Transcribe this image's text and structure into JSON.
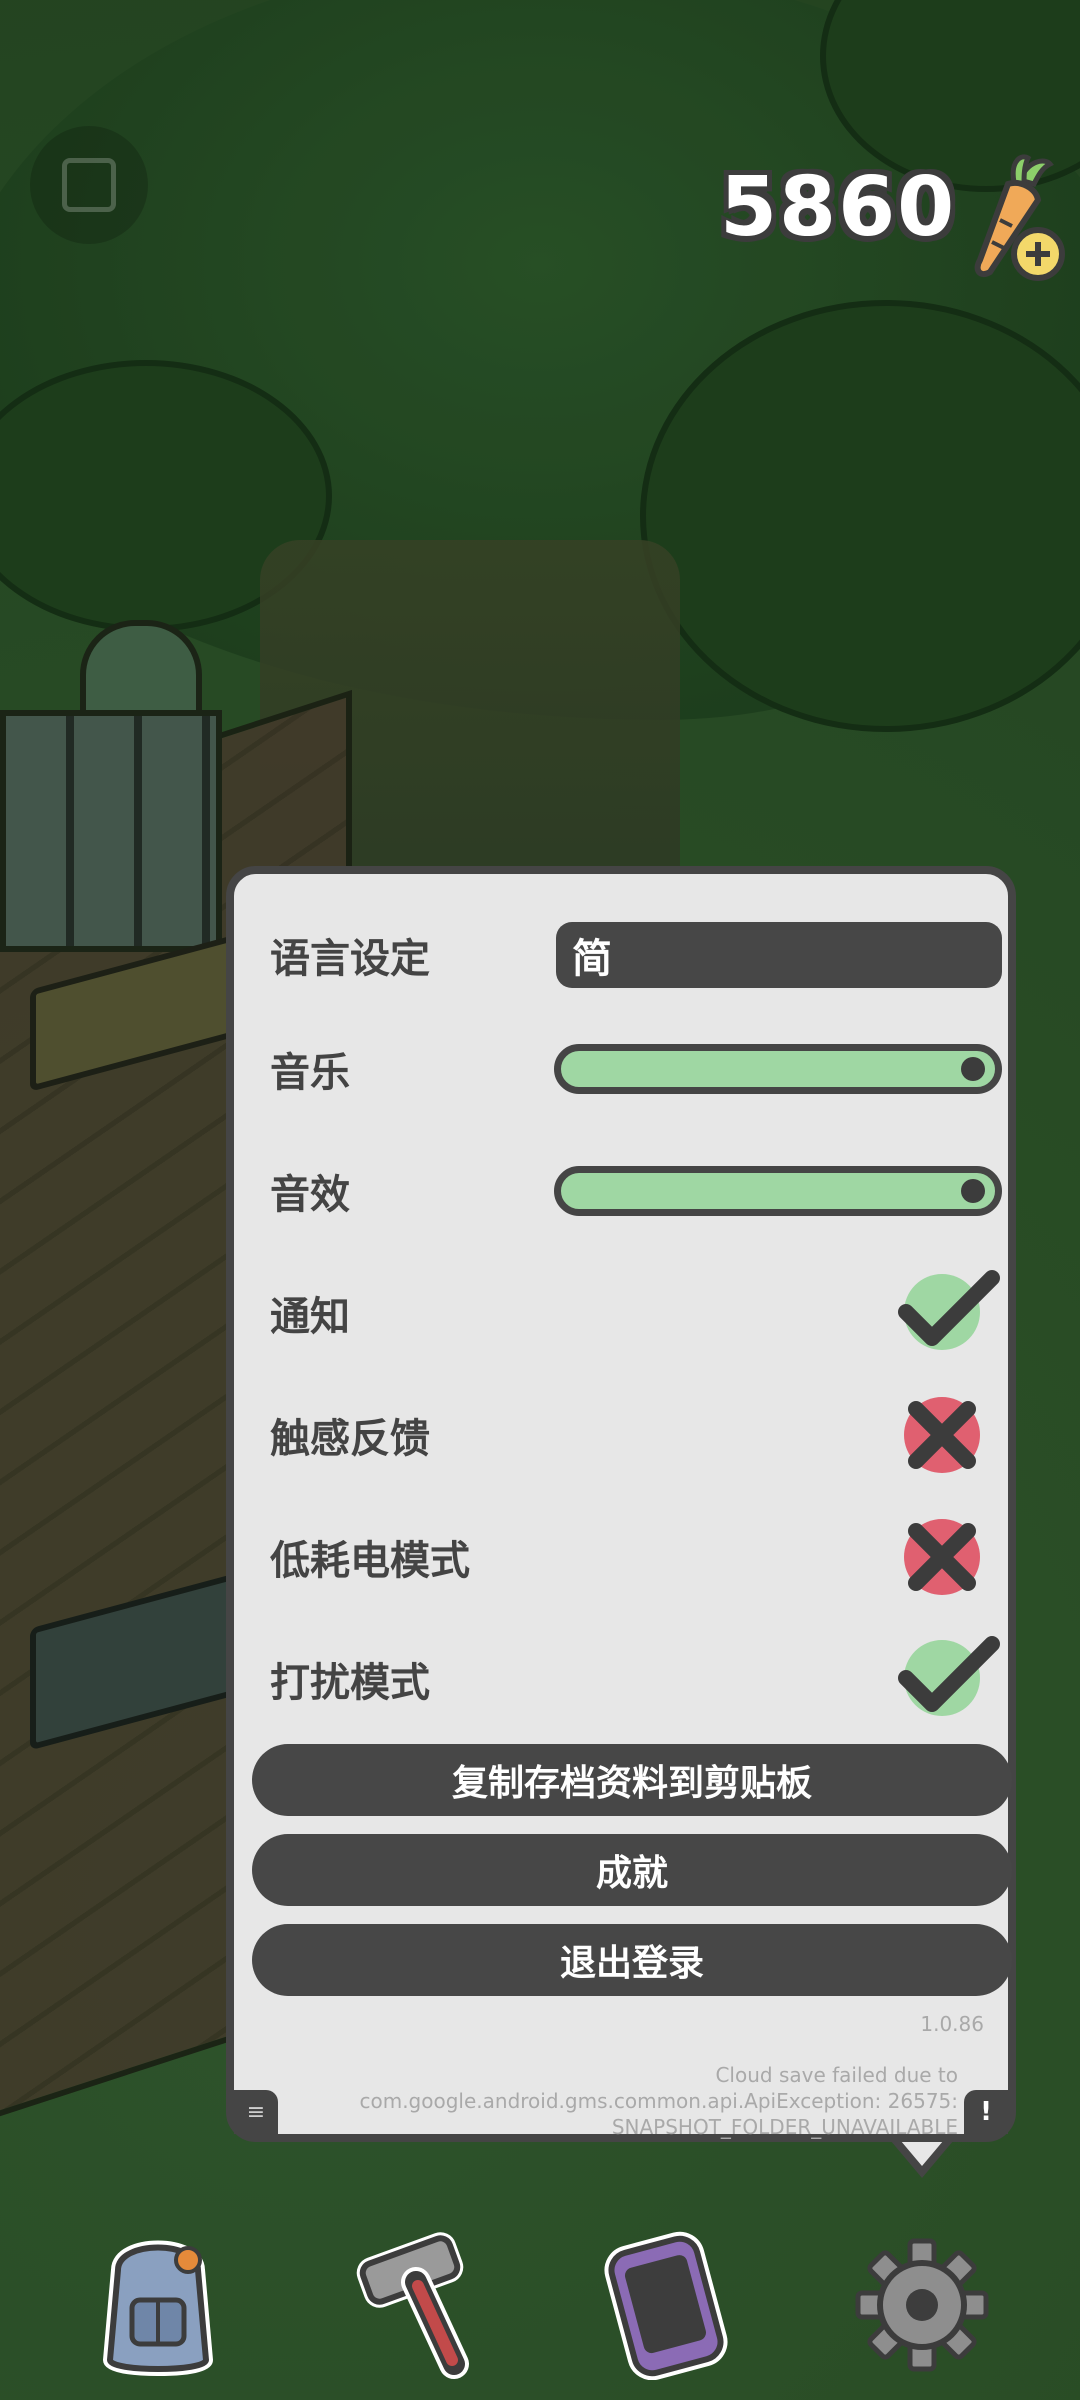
{
  "hud": {
    "carrot_count": "5860",
    "menu_icon": "square-menu-icon",
    "currency_icon": "carrot-plus-icon"
  },
  "settings": {
    "language": {
      "label": "语言设定",
      "value": "简"
    },
    "music": {
      "label": "音乐",
      "level": 1.0
    },
    "sound_effects": {
      "label": "音效",
      "level": 1.0
    },
    "notifications": {
      "label": "通知",
      "state": "on"
    },
    "haptic_feedback": {
      "label": "触感反馈",
      "state": "off"
    },
    "low_power_mode": {
      "label": "低耗电模式",
      "state": "off"
    },
    "do_not_disturb": {
      "label": "打扰模式",
      "state": "on"
    },
    "buttons": {
      "copy_save": "复制存档资料到剪贴板",
      "achievements": "成就",
      "logout": "退出登录"
    },
    "version": "1.0.86",
    "cloud_error": {
      "line1": "Cloud save failed due to",
      "line2": "com.google.android.gms.common.api.ApiException: 26575:",
      "line3": "SNAPSHOT_FOLDER_UNAVAILABLE"
    },
    "corner_left_glyph": "≡",
    "corner_right_glyph": "!"
  },
  "bottom_nav": [
    {
      "icon": "backpack-icon"
    },
    {
      "icon": "hammer-icon"
    },
    {
      "icon": "phone-icon"
    },
    {
      "icon": "gear-icon"
    }
  ],
  "colors": {
    "panel_bg": "#e7e7e7",
    "panel_border": "#454545",
    "slider_fill": "#9fd7a3",
    "check_green": "#9fd7a3",
    "cross_red": "#e06070"
  }
}
